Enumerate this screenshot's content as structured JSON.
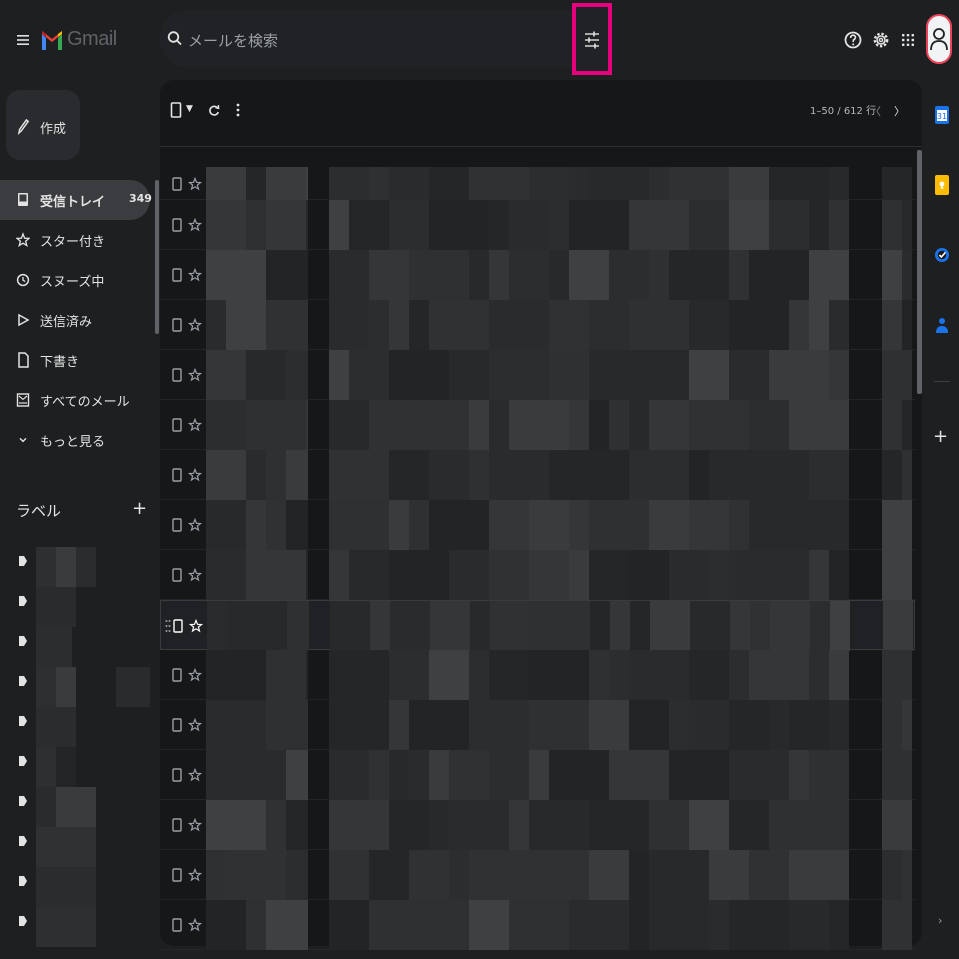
{
  "app": {
    "brand": "Gmail",
    "icons": {
      "menu": "hamburger-menu-icon",
      "logo": "gmail-logo-icon"
    }
  },
  "search": {
    "placeholder": "メールを検索",
    "filter_icon": "search-options-icon",
    "highlight_color": "#e6007e"
  },
  "header_icons": [
    "help-icon",
    "gear-icon",
    "apps-grid-icon",
    "account-avatar-icon"
  ],
  "compose": {
    "label": "作成"
  },
  "nav": {
    "items": [
      {
        "label": "受信トレイ",
        "icon": "inbox-icon",
        "count": "349",
        "active": true
      },
      {
        "label": "スター付き",
        "icon": "star-icon"
      },
      {
        "label": "スヌーズ中",
        "icon": "clock-icon"
      },
      {
        "label": "送信済み",
        "icon": "send-icon"
      },
      {
        "label": "下書き",
        "icon": "draft-icon"
      },
      {
        "label": "すべてのメール",
        "icon": "all-mail-icon"
      },
      {
        "label": "もっと見る",
        "icon": "chevron-down-icon"
      }
    ]
  },
  "labels": {
    "title": "ラベル",
    "add": "+"
  },
  "toolbar": {
    "pager": "1–50 / 612 行",
    "prev": "〈",
    "next": "〉"
  },
  "side_panel": {
    "icons": [
      "calendar-icon",
      "keep-icon",
      "tasks-icon",
      "contacts-icon",
      "add-icon",
      "expand-chevron-icon"
    ],
    "add": "+",
    "expand": "›"
  },
  "colors": {
    "background": "#1e1f21",
    "panel": "#161719",
    "accent": "#e6007e"
  }
}
